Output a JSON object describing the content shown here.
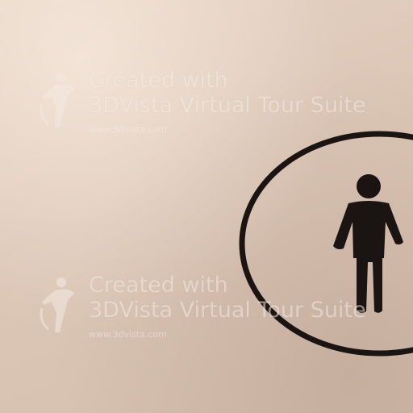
{
  "scene": {
    "description_icon": "male-restroom-pictogram-icon",
    "colors": {
      "wall": "#dfcabb",
      "ink": "#1a1412",
      "watermark": "#f4ebe3"
    }
  },
  "watermarks": [
    {
      "line1": "Created with",
      "line2": "3DVista Virtual Tour Suite",
      "url": "www.3dvista.com"
    },
    {
      "line1": "Created with",
      "line2": "3DVista Virtual Tour Suite",
      "url": "www.3dvista.com"
    }
  ]
}
